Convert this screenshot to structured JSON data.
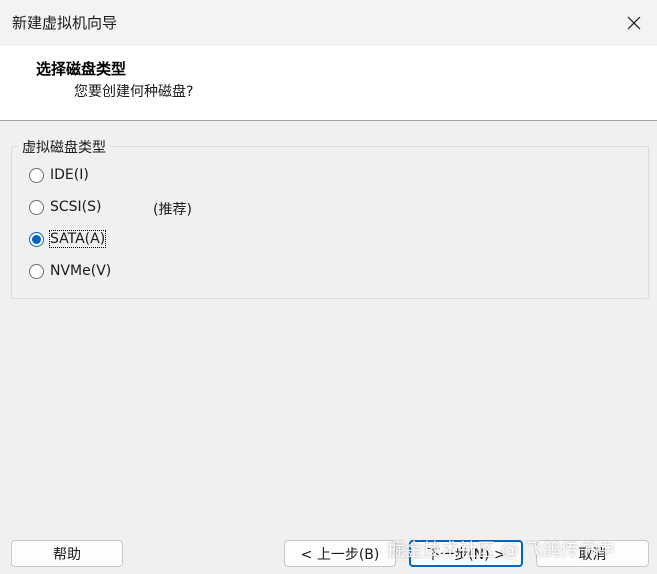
{
  "window": {
    "title": "新建虚拟机向导",
    "close_glyph": "✕"
  },
  "header": {
    "title": "选择磁盘类型",
    "subtitle": "您要创建何种磁盘?"
  },
  "disk_type_group": {
    "legend": "虚拟磁盘类型",
    "options": [
      {
        "label": "IDE(I)",
        "checked": false
      },
      {
        "label": "SCSI(S)",
        "checked": false,
        "note": "(推荐)"
      },
      {
        "label": "SATA(A)",
        "checked": true
      },
      {
        "label": "NVMe(V)",
        "checked": false
      }
    ]
  },
  "buttons": {
    "help": "帮助",
    "back": "< 上一步(B)",
    "next": "下一步(N) >",
    "cancel": "取消"
  },
  "watermark": "掘金技术社区 @ 飞鸽传书中",
  "colors": {
    "accent": "#0067c0",
    "background": "#f0f0f0"
  }
}
